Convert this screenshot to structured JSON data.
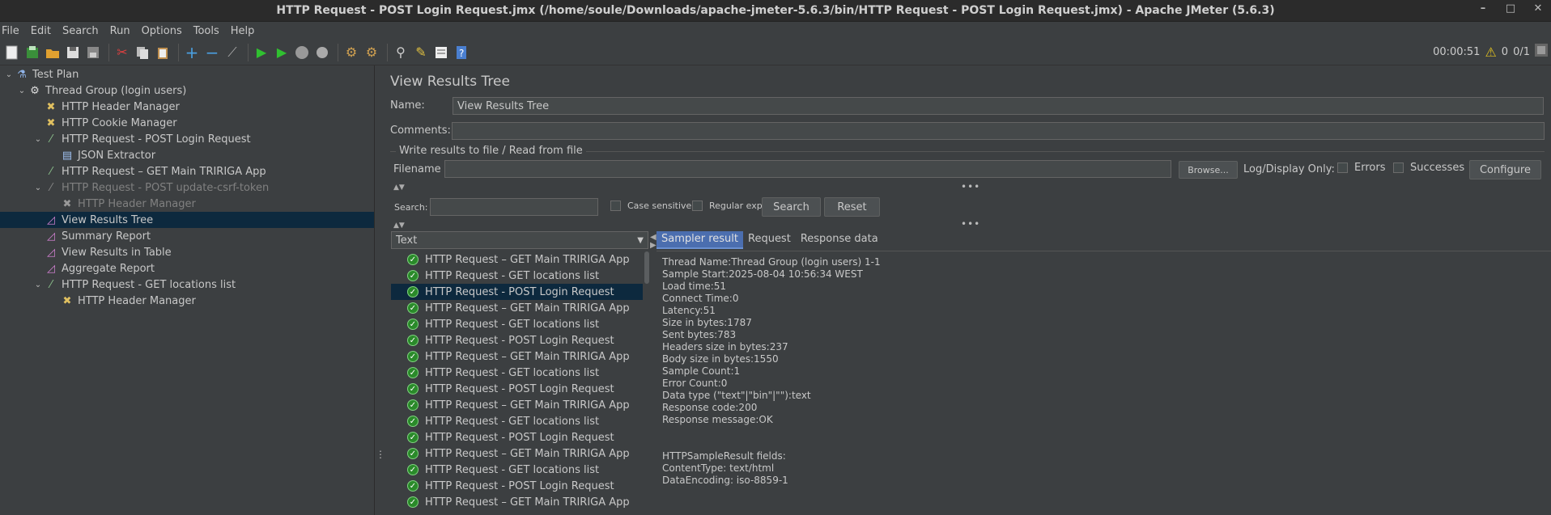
{
  "window": {
    "title": "HTTP Request - POST Login Request.jmx (/home/soule/Downloads/apache-jmeter-5.6.3/bin/HTTP Request - POST Login Request.jmx) - Apache JMeter (5.6.3)",
    "minimize": "–",
    "maximize": "□",
    "close": "✕"
  },
  "menu": [
    "File",
    "Edit",
    "Search",
    "Run",
    "Options",
    "Tools",
    "Help"
  ],
  "status": {
    "elapsed": "00:00:51",
    "warnings": "0",
    "threads": "0/1"
  },
  "tree": [
    {
      "label": "Test Plan",
      "icon": "flask-icon"
    },
    {
      "label": "Thread Group (login users)",
      "icon": "gear-icon"
    },
    {
      "label": "HTTP Header Manager",
      "icon": "tools-icon"
    },
    {
      "label": "HTTP Cookie Manager",
      "icon": "tools-icon"
    },
    {
      "label": "HTTP Request - POST Login Request",
      "icon": "pipette-icon"
    },
    {
      "label": "JSON Extractor",
      "icon": "document-icon"
    },
    {
      "label": "HTTP Request – GET Main TRIRIGA App",
      "icon": "pipette-icon"
    },
    {
      "label": "HTTP Request - POST update-csrf-token",
      "icon": "pipette-icon"
    },
    {
      "label": "HTTP Header Manager",
      "icon": "tools-icon"
    },
    {
      "label": "View Results Tree",
      "icon": "chart-icon"
    },
    {
      "label": "Summary Report",
      "icon": "chart-icon"
    },
    {
      "label": "View Results in Table",
      "icon": "chart-icon"
    },
    {
      "label": "Aggregate Report",
      "icon": "chart-icon"
    },
    {
      "label": "HTTP Request - GET locations list",
      "icon": "pipette-icon"
    },
    {
      "label": "HTTP Header Manager",
      "icon": "tools-icon"
    }
  ],
  "panel": {
    "title": "View Results Tree",
    "name_label": "Name:",
    "name_value": "View Results Tree",
    "comments_label": "Comments:",
    "comments_value": "",
    "file_legend": "Write results to file / Read from file",
    "filename_label": "Filename",
    "filename_value": "",
    "browse": "Browse...",
    "log_display": "Log/Display Only:",
    "errors": "Errors",
    "successes": "Successes",
    "configure": "Configure",
    "search_label": "Search:",
    "search_value": "",
    "case_sensitive": "Case sensitive",
    "regular_exp": "Regular exp.",
    "search_btn": "Search",
    "reset_btn": "Reset",
    "renderer": "Text"
  },
  "results": [
    "HTTP Request – GET Main TRIRIGA App",
    "HTTP Request - GET locations list",
    "HTTP Request - POST Login Request",
    "HTTP Request – GET Main TRIRIGA App",
    "HTTP Request - GET locations list",
    "HTTP Request - POST Login Request",
    "HTTP Request – GET Main TRIRIGA App",
    "HTTP Request - GET locations list",
    "HTTP Request - POST Login Request",
    "HTTP Request – GET Main TRIRIGA App",
    "HTTP Request - GET locations list",
    "HTTP Request - POST Login Request",
    "HTTP Request – GET Main TRIRIGA App",
    "HTTP Request - GET locations list",
    "HTTP Request - POST Login Request",
    "HTTP Request – GET Main TRIRIGA App"
  ],
  "tabs": [
    "Sampler result",
    "Request",
    "Response data"
  ],
  "sampler_result": [
    "Thread Name:Thread Group (login users) 1-1",
    "Sample Start:2025-08-04 10:56:34 WEST",
    "Load time:51",
    "Connect Time:0",
    "Latency:51",
    "Size in bytes:1787",
    "Sent bytes:783",
    "Headers size in bytes:237",
    "Body size in bytes:1550",
    "Sample Count:1",
    "Error Count:0",
    "Data type (\"text\"|\"bin\"|\"\"):text",
    "Response code:200",
    "Response message:OK",
    "",
    "",
    "HTTPSampleResult fields:",
    "ContentType: text/html",
    "DataEncoding: iso-8859-1"
  ]
}
